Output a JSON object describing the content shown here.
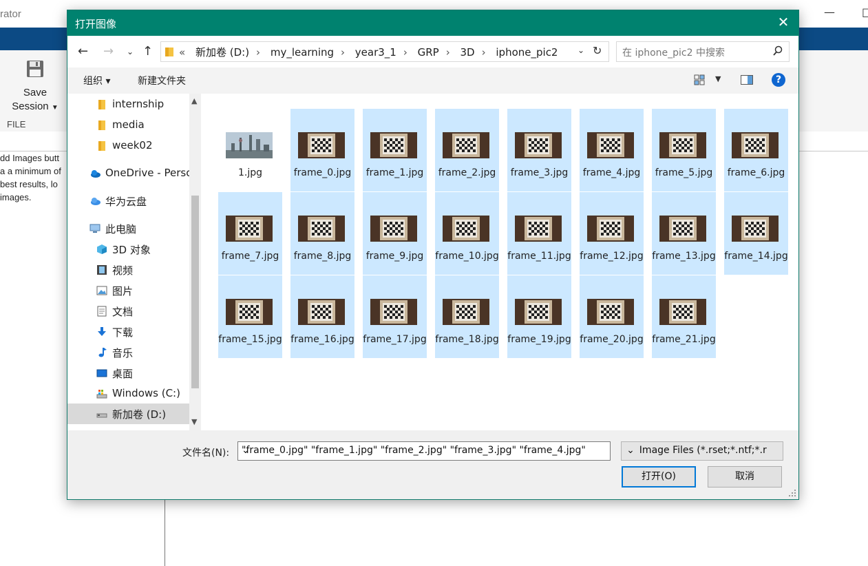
{
  "app": {
    "title_fragment": "rator",
    "save_session_label": "Save",
    "save_session_label2": "Session",
    "save_icon": "floppy-disk-icon",
    "file_section_label": "FILE",
    "help_lines": [
      "dd Images butt",
      "a a minimum of",
      " best results, lo",
      "images."
    ]
  },
  "dialog": {
    "title": "打开图像",
    "close_icon": "close-icon",
    "breadcrumb_lead": "«",
    "breadcrumbs": [
      "新加卷 (D:)",
      "my_learning",
      "year3_1",
      "GRP",
      "3D",
      "iphone_pic2"
    ],
    "search_placeholder": "在 iphone_pic2 中搜索",
    "toolbar": {
      "organize": "组织 ▾",
      "new_folder": "新建文件夹"
    },
    "help_icon_glyph": "?",
    "nav_items": [
      {
        "label": "internship",
        "icon": "folder-icon"
      },
      {
        "label": "media",
        "icon": "folder-icon"
      },
      {
        "label": "week02",
        "icon": "folder-icon"
      },
      {
        "label": "OneDrive - Perso",
        "icon": "cloud-icon"
      },
      {
        "label": "华为云盘",
        "icon": "cloud-icon"
      },
      {
        "label": "此电脑",
        "icon": "computer-icon"
      },
      {
        "label": "3D 对象",
        "icon": "cube-icon"
      },
      {
        "label": "视频",
        "icon": "film-icon"
      },
      {
        "label": "图片",
        "icon": "picture-icon"
      },
      {
        "label": "文档",
        "icon": "document-icon"
      },
      {
        "label": "下载",
        "icon": "download-icon"
      },
      {
        "label": "音乐",
        "icon": "music-icon"
      },
      {
        "label": "桌面",
        "icon": "desktop-icon"
      },
      {
        "label": "Windows (C:)",
        "icon": "drive-icon"
      },
      {
        "label": "新加卷 (D:)",
        "icon": "drive-icon"
      }
    ],
    "files": [
      {
        "name": "1.jpg",
        "selected": false,
        "thumb": "skyline"
      },
      {
        "name": "frame_0.jpg",
        "selected": true,
        "thumb": "checker"
      },
      {
        "name": "frame_1.jpg",
        "selected": true,
        "thumb": "checker"
      },
      {
        "name": "frame_2.jpg",
        "selected": true,
        "thumb": "checker"
      },
      {
        "name": "frame_3.jpg",
        "selected": true,
        "thumb": "checker"
      },
      {
        "name": "frame_4.jpg",
        "selected": true,
        "thumb": "checker"
      },
      {
        "name": "frame_5.jpg",
        "selected": true,
        "thumb": "checker"
      },
      {
        "name": "frame_6.jpg",
        "selected": true,
        "thumb": "checker"
      },
      {
        "name": "frame_7.jpg",
        "selected": true,
        "thumb": "checker"
      },
      {
        "name": "frame_8.jpg",
        "selected": true,
        "thumb": "checker"
      },
      {
        "name": "frame_9.jpg",
        "selected": true,
        "thumb": "checker"
      },
      {
        "name": "frame_10.jpg",
        "selected": true,
        "thumb": "checker"
      },
      {
        "name": "frame_11.jpg",
        "selected": true,
        "thumb": "checker"
      },
      {
        "name": "frame_12.jpg",
        "selected": true,
        "thumb": "checker"
      },
      {
        "name": "frame_13.jpg",
        "selected": true,
        "thumb": "checker"
      },
      {
        "name": "frame_14.jpg",
        "selected": true,
        "thumb": "checker"
      },
      {
        "name": "frame_15.jpg",
        "selected": true,
        "thumb": "checker"
      },
      {
        "name": "frame_16.jpg",
        "selected": true,
        "thumb": "checker"
      },
      {
        "name": "frame_17.jpg",
        "selected": true,
        "thumb": "checker"
      },
      {
        "name": "frame_18.jpg",
        "selected": true,
        "thumb": "checker"
      },
      {
        "name": "frame_19.jpg",
        "selected": true,
        "thumb": "checker"
      },
      {
        "name": "frame_20.jpg",
        "selected": true,
        "thumb": "checker"
      },
      {
        "name": "frame_21.jpg",
        "selected": true,
        "thumb": "checker"
      }
    ],
    "filename_label": "文件名(N):",
    "filename_value": "\"frame_0.jpg\" \"frame_1.jpg\" \"frame_2.jpg\" \"frame_3.jpg\" \"frame_4.jpg\"",
    "filetype_value": "All Image Files (*.rset;*.ntf;*.r",
    "open_button": "打开(O)",
    "cancel_button": "取消"
  },
  "colors": {
    "dialog_titlebar": "#00826f",
    "app_band": "#0c4a84",
    "selection": "#cce8ff",
    "primary_border": "#0078d7"
  }
}
